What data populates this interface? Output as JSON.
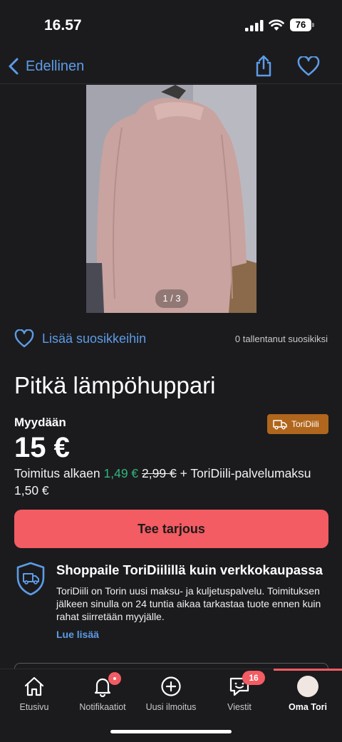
{
  "status": {
    "time": "16.57",
    "battery": "76"
  },
  "nav": {
    "back_label": "Edellinen"
  },
  "gallery": {
    "counter": "1 / 3"
  },
  "favorite": {
    "label": "Lisää suosikkeihin",
    "saved_count": "0 tallentanut suosikiksi"
  },
  "listing": {
    "title": "Pitkä lämpöhuppari",
    "sale_type": "Myydään",
    "badge": "ToriDiili",
    "price": "15 €",
    "shipping_prefix": "Toimitus alkaen",
    "shipping_price": "1,49 €",
    "shipping_old_price": "2,99 €",
    "shipping_suffix": "+ ToriDiili-palvelumaksu 1,50 €"
  },
  "offer_button": "Tee tarjous",
  "promo": {
    "title": "Shoppaile ToriDiilillä kuin verkkokaupassa",
    "text": "ToriDiili on Torin uusi maksu- ja kuljetuspalvelu. Toimituksen jälkeen sinulla on 24 tuntia aikaa tarkastaa tuote ennen kuin rahat siirretään myyjälle.",
    "link": "Lue lisää"
  },
  "tabs": [
    {
      "label": "Etusivu",
      "icon": "home-icon"
    },
    {
      "label": "Notifikaatiot",
      "icon": "bell-icon"
    },
    {
      "label": "Uusi ilmoitus",
      "icon": "plus-circle-icon"
    },
    {
      "label": "Viestit",
      "icon": "chat-icon",
      "badge": "16"
    },
    {
      "label": "Oma Tori",
      "icon": "avatar",
      "active": true
    }
  ],
  "colors": {
    "accent_blue": "#5d9ce6",
    "accent_red": "#f25c62",
    "green": "#2fb67c",
    "badge_orange": "#b0661d",
    "background": "#1b1b1e"
  }
}
